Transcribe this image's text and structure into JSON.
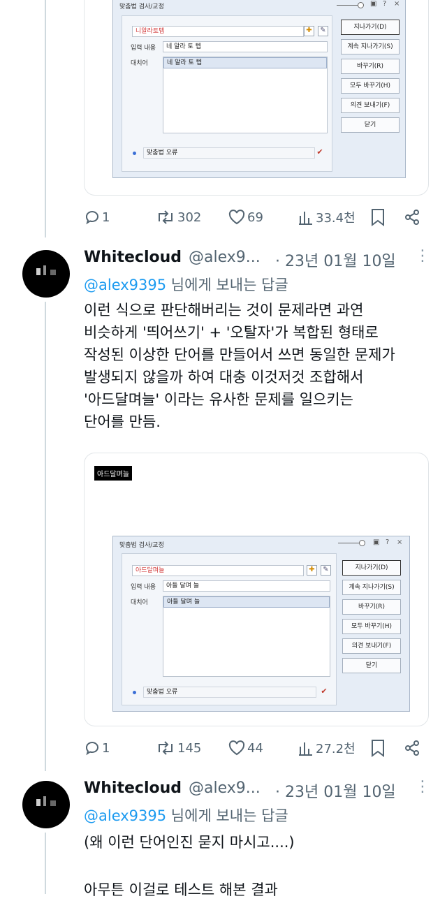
{
  "tweet1": {
    "dialog": {
      "title": "맞춤법 검사/교정",
      "error_word": "니알라토텝",
      "input_label": "입력 내용",
      "input_value": "네 알라 토 텝",
      "replace_label": "대치어",
      "replace_value": "네 알라 토 텝",
      "buttons": [
        "지나가기(D)",
        "계속 지나가기(S)",
        "바꾸기(R)",
        "모두 바꾸기(H)",
        "의견 보내기(F)",
        "닫기"
      ],
      "status": "맞춤법 오류"
    },
    "stats": {
      "replies": "1",
      "retweets": "302",
      "likes": "69",
      "views": "33.4천"
    }
  },
  "tweet2": {
    "name": "Whitecloud",
    "handle": "@alex9...",
    "date": "· 23년 01월 10일",
    "reply_mention": "@alex9395",
    "reply_suffix": " 님에게 보내는 답글",
    "text": "이런 식으로 판단해버리는 것이 문제라면 과연\n비슷하게 '띄어쓰기' + '오탈자'가 복합된 형태로\n작성된 이상한 단어를 만들어서 쓰면 동일한 문제가\n발생되지 않을까 하여 대충 이것저것 조합해서\n'아드달며늘' 이라는 유사한 문제를 일으키는\n단어를 만듬.",
    "image_label": "아드달며늘",
    "dialog": {
      "title": "맞춤법 검사/교정",
      "error_word": "아드달며늘",
      "input_label": "입력 내용",
      "input_value": "아들 달며 늘",
      "replace_label": "대치어",
      "replace_value": "아들 달며 늘",
      "buttons": [
        "지나가기(D)",
        "계속 지나가기(S)",
        "바꾸기(R)",
        "모두 바꾸기(H)",
        "의견 보내기(F)",
        "닫기"
      ],
      "status": "맞춤법 오류"
    },
    "stats": {
      "replies": "1",
      "retweets": "145",
      "likes": "44",
      "views": "27.2천"
    }
  },
  "tweet3": {
    "name": "Whitecloud",
    "handle": "@alex9...",
    "date": "· 23년 01월 10일",
    "reply_mention": "@alex9395",
    "reply_suffix": " 님에게 보내는 답글",
    "text_line1": "(왜 이런 단어인진 묻지 마시고....)",
    "text_line2": "아무튼 이걸로 테스트 해본 결과"
  },
  "colors": {
    "link": "#1d9bf0",
    "muted": "#536471",
    "text": "#0f1419"
  }
}
